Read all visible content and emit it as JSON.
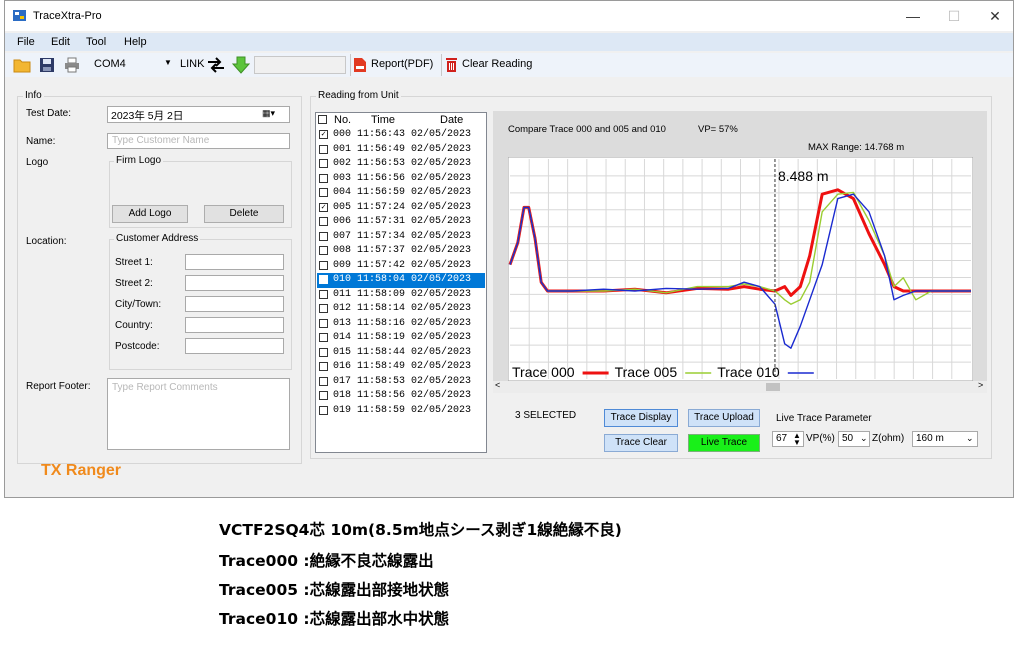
{
  "window": {
    "title": "TraceXtra-Pro",
    "controls": {
      "minimize": "—",
      "maximize": "☐",
      "close": "✕"
    }
  },
  "menu": [
    "File",
    "Edit",
    "Tool",
    "Help"
  ],
  "toolbar": {
    "port": "COM4",
    "link_label": "LINK",
    "report_label": "Report(PDF)",
    "clear_label": "Clear Reading"
  },
  "info": {
    "group_title": "Info",
    "test_date_label": "Test Date:",
    "test_date_value": "2023年  5月  2日",
    "name_label": "Name:",
    "name_placeholder": "Type Customer Name",
    "logo_label": "Logo",
    "firm_logo_title": "Firm Logo",
    "add_logo": "Add Logo",
    "delete": "Delete",
    "location_label": "Location:",
    "address_title": "Customer Address",
    "street1": "Street 1:",
    "street2": "Street 2:",
    "city": "City/Town:",
    "country": "Country:",
    "postcode": "Postcode:",
    "footer_label": "Report Footer:",
    "footer_placeholder": "Type Report Comments",
    "brand": "TX Ranger"
  },
  "reading": {
    "group_title": "Reading from Unit",
    "headers": {
      "no": "No.",
      "time": "Time",
      "date": "Date"
    },
    "rows": [
      {
        "text": "000 11:56:43 02/05/2023",
        "checked": true,
        "selected": false
      },
      {
        "text": "001 11:56:49 02/05/2023",
        "checked": false,
        "selected": false
      },
      {
        "text": "002 11:56:53 02/05/2023",
        "checked": false,
        "selected": false
      },
      {
        "text": "003 11:56:56 02/05/2023",
        "checked": false,
        "selected": false
      },
      {
        "text": "004 11:56:59 02/05/2023",
        "checked": false,
        "selected": false
      },
      {
        "text": "005 11:57:24 02/05/2023",
        "checked": true,
        "selected": false
      },
      {
        "text": "006 11:57:31 02/05/2023",
        "checked": false,
        "selected": false
      },
      {
        "text": "007 11:57:34 02/05/2023",
        "checked": false,
        "selected": false
      },
      {
        "text": "008 11:57:37 02/05/2023",
        "checked": false,
        "selected": false
      },
      {
        "text": "009 11:57:42 02/05/2023",
        "checked": false,
        "selected": false
      },
      {
        "text": "010 11:58:04 02/05/2023",
        "checked": true,
        "selected": true
      },
      {
        "text": "011 11:58:09 02/05/2023",
        "checked": false,
        "selected": false
      },
      {
        "text": "012 11:58:14 02/05/2023",
        "checked": false,
        "selected": false
      },
      {
        "text": "013 11:58:16 02/05/2023",
        "checked": false,
        "selected": false
      },
      {
        "text": "014 11:58:19 02/05/2023",
        "checked": false,
        "selected": false
      },
      {
        "text": "015 11:58:44 02/05/2023",
        "checked": false,
        "selected": false
      },
      {
        "text": "016 11:58:49 02/05/2023",
        "checked": false,
        "selected": false
      },
      {
        "text": "017 11:58:53 02/05/2023",
        "checked": false,
        "selected": false
      },
      {
        "text": "018 11:58:56 02/05/2023",
        "checked": false,
        "selected": false
      },
      {
        "text": "019 11:58:59 02/05/2023",
        "checked": false,
        "selected": false
      }
    ]
  },
  "trace_panel": {
    "compare_text": "Compare Trace 000 and 005 and 010",
    "vp_text": "VP= 57%",
    "max_range": "MAX Range: 14.768 m",
    "cursor_label": "8.488 m",
    "legend": [
      {
        "name": "Trace 000",
        "color": "#ee1111"
      },
      {
        "name": "Trace 005",
        "color": "#9acd32"
      },
      {
        "name": "Trace 010",
        "color": "#1a2ad0"
      }
    ],
    "selected_count": "3 SELECTED",
    "buttons": {
      "trace_display": "Trace Display",
      "trace_upload": "Trace Upload",
      "trace_clear": "Trace Clear",
      "live_trace": "Live Trace"
    },
    "live_param_title": "Live Trace Parameter",
    "vp_value": "67",
    "vp_label": "VP(%)",
    "z_value": "50",
    "z_label": "Z(ohm)",
    "range_value": "160 m"
  },
  "chart_data": {
    "type": "line",
    "x": [
      0,
      0.25,
      0.45,
      0.6,
      0.8,
      1.0,
      1.2,
      1.4,
      1.6,
      2.0,
      3,
      4,
      5,
      6,
      7,
      7.5,
      8.0,
      8.488,
      8.8,
      9.0,
      9.3,
      9.6,
      10.0,
      10.5,
      11.0,
      11.5,
      12.0,
      12.3,
      12.6,
      13.0,
      13.5,
      14.0,
      14.768
    ],
    "series": [
      {
        "name": "Trace 000",
        "values": [
          0.3,
          0.55,
          0.95,
          0.95,
          0.6,
          0.1,
          0,
          0,
          0,
          0,
          0,
          0.02,
          -0.02,
          0.03,
          0.02,
          0.05,
          0.02,
          0,
          0.05,
          -0.05,
          0.05,
          0.4,
          1.1,
          1.15,
          1.05,
          0.65,
          0.3,
          0.05,
          0,
          0,
          0,
          0,
          0
        ]
      },
      {
        "name": "Trace 005",
        "values": [
          0.3,
          0.55,
          0.95,
          0.95,
          0.6,
          0.1,
          0,
          0,
          0,
          0,
          0,
          0.02,
          -0.02,
          0.05,
          0.05,
          0.08,
          0.05,
          0,
          -0.1,
          -0.15,
          -0.1,
          0.1,
          0.9,
          1.1,
          1.12,
          0.8,
          0.4,
          0.05,
          0.15,
          -0.1,
          0,
          0,
          0
        ]
      },
      {
        "name": "Trace 010",
        "values": [
          0.3,
          0.55,
          0.95,
          0.95,
          0.6,
          0.1,
          0,
          0,
          0,
          0,
          0.02,
          0,
          0.03,
          0.02,
          0.03,
          0.1,
          0.05,
          -0.15,
          -0.6,
          -0.65,
          -0.4,
          -0.1,
          0.3,
          1.05,
          1.1,
          0.9,
          0.4,
          -0.1,
          -0.05,
          0,
          0,
          0,
          0
        ]
      }
    ],
    "xlim": [
      0,
      14.768
    ],
    "ylim": [
      -1.0,
      1.5
    ],
    "cursor_x": 8.488,
    "grid": true,
    "legend": "bottom"
  },
  "caption": {
    "line1": "VCTF2SQ4芯 10m(8.5m地点シース剥ぎ1線絶縁不良)",
    "line2": "Trace000 :絶縁不良芯線露出",
    "line3": "Trace005 :芯線露出部接地状態",
    "line4": "Trace010 :芯線露出部水中状態"
  }
}
